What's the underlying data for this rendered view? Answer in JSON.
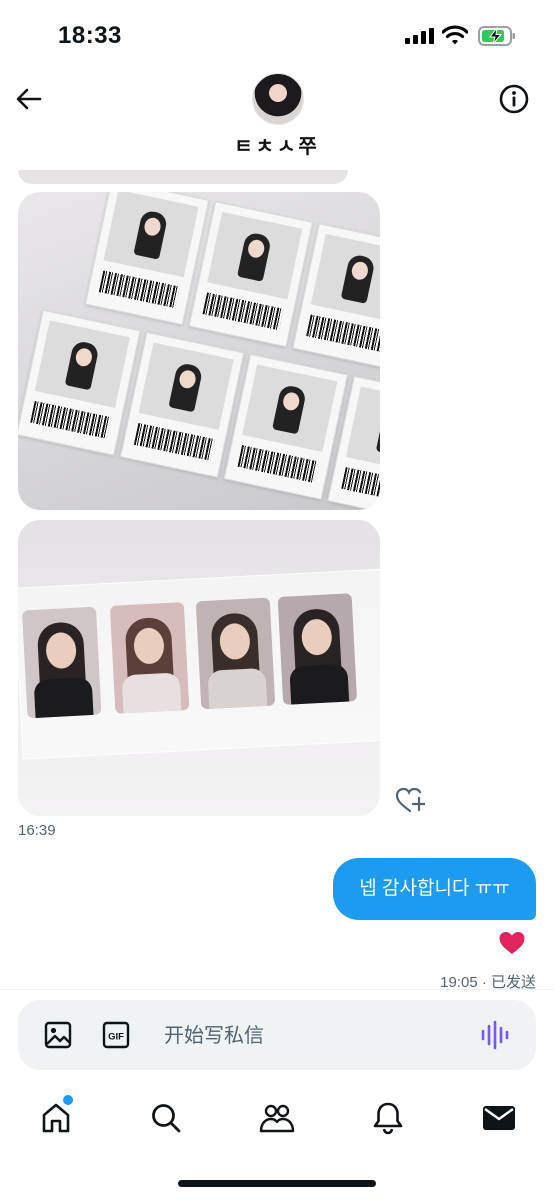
{
  "status_bar": {
    "time": "18:33"
  },
  "header": {
    "contact_name": "ㅌㅊㅅ쭈"
  },
  "conversation": {
    "received_timestamp": "16:39",
    "sent_message": "넵 감사합니다 ㅠㅠ",
    "sent_meta": "19:05 · 已发送",
    "reaction": "heart"
  },
  "composer": {
    "placeholder": "开始写私信"
  },
  "icons": {
    "back": "arrow-left-icon",
    "info": "info-icon",
    "image": "image-icon",
    "gif": "gif-icon",
    "voice": "voice-waveform-icon",
    "add_reaction": "heart-plus-icon"
  },
  "tabs": [
    {
      "name": "home",
      "has_badge": true
    },
    {
      "name": "search"
    },
    {
      "name": "communities"
    },
    {
      "name": "notifications"
    },
    {
      "name": "messages",
      "selected": true
    }
  ],
  "colors": {
    "accent": "#1d9bf0",
    "voice": "#7856ff",
    "heart": "#e0245e",
    "text": "#0f1419",
    "muted": "#536471"
  }
}
